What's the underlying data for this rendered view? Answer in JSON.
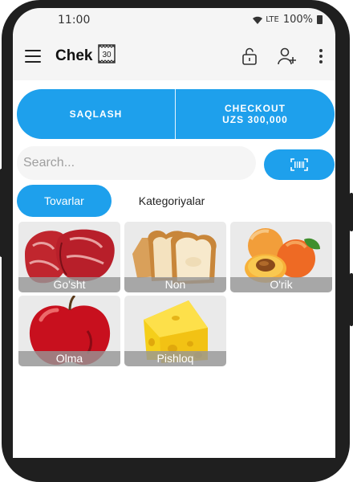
{
  "status_bar": {
    "time": "11:00",
    "network": "LTE",
    "battery": "100%"
  },
  "app_bar": {
    "title": "Chek",
    "calendar_day": "30",
    "icons": [
      "menu-icon",
      "calendar-icon",
      "unlock-icon",
      "add-user-icon",
      "more-vert-icon"
    ]
  },
  "actions": {
    "save_label": "SAQLASH",
    "checkout_label": "CHECKOUT",
    "checkout_amount": "UZS 300,000"
  },
  "search": {
    "placeholder": "Search..."
  },
  "tabs": [
    {
      "label": "Tovarlar",
      "active": true
    },
    {
      "label": "Kategoriyalar",
      "active": false
    }
  ],
  "products": [
    {
      "name": "Go'sht",
      "icon": "meat-image"
    },
    {
      "name": "Non",
      "icon": "bread-image"
    },
    {
      "name": "O'rik",
      "icon": "apricot-image"
    },
    {
      "name": "Olma",
      "icon": "apple-image"
    },
    {
      "name": "Pishloq",
      "icon": "cheese-image"
    }
  ],
  "colors": {
    "accent": "#1ea0ec",
    "frame": "#1f1f1f",
    "tile_bg": "#eaeaea"
  }
}
